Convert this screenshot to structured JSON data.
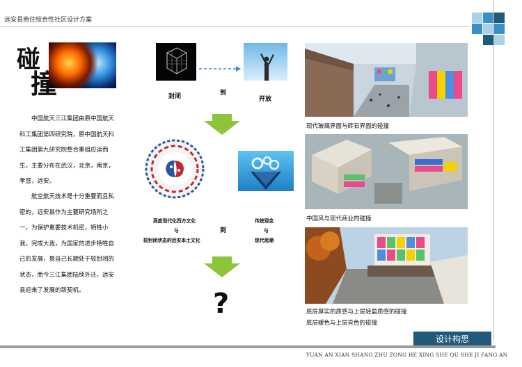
{
  "header": {
    "title": "远安县商住综合性社区设计方案"
  },
  "colors": {
    "accent_dark": "#1f5a7a",
    "accent_blue": "#3b8fc7",
    "accent_light": "#a8d1ea",
    "arrow_green": "#8cc43a"
  },
  "headline": {
    "char1": "碰",
    "char2": "撞"
  },
  "body": {
    "para1": "中国航天三江集团由原中国航天科工集团第四研究院，原中国航天科工集团第九研究院整合重组应运而生，主要分布在武汉，北京，南京，孝感，远安。",
    "para2": "航空航天技术是十分重要而且私密的，远安县作为主要研究场所之一，为保护重要技术机密，牺牲小我，完成大我，为国家的进步牺牲自己的发展，是自己长期处于较封闭的状态，而今三江集团陆续外迁，远安县迎来了发展的新契机。"
  },
  "diagram": {
    "closed": "封闭",
    "to1": "到",
    "open": "开放",
    "western_line1": "高度现代化西方文化",
    "western_line2": "与",
    "western_line3": "较封闭状态的远安本土文化",
    "to2": "到",
    "tradition_line1": "传统观念",
    "tradition_line2": "与",
    "tradition_line3": "现代思潮",
    "question": "?"
  },
  "captions": {
    "cap1": "现代玻璃界面与砖石界面的碰撞",
    "cap2": "中国风与现代商业的碰撞",
    "cap3a": "底层厚实的质感与上层轻盈质感的碰撞",
    "cap3b": "底层暖色与上层亮色的碰撞"
  },
  "footer": {
    "design_label": "设计构思",
    "pinyin": "YUAN AN XIAN SHANG ZHU ZONG HE XING SHE QU SHE JI FANG AN"
  }
}
